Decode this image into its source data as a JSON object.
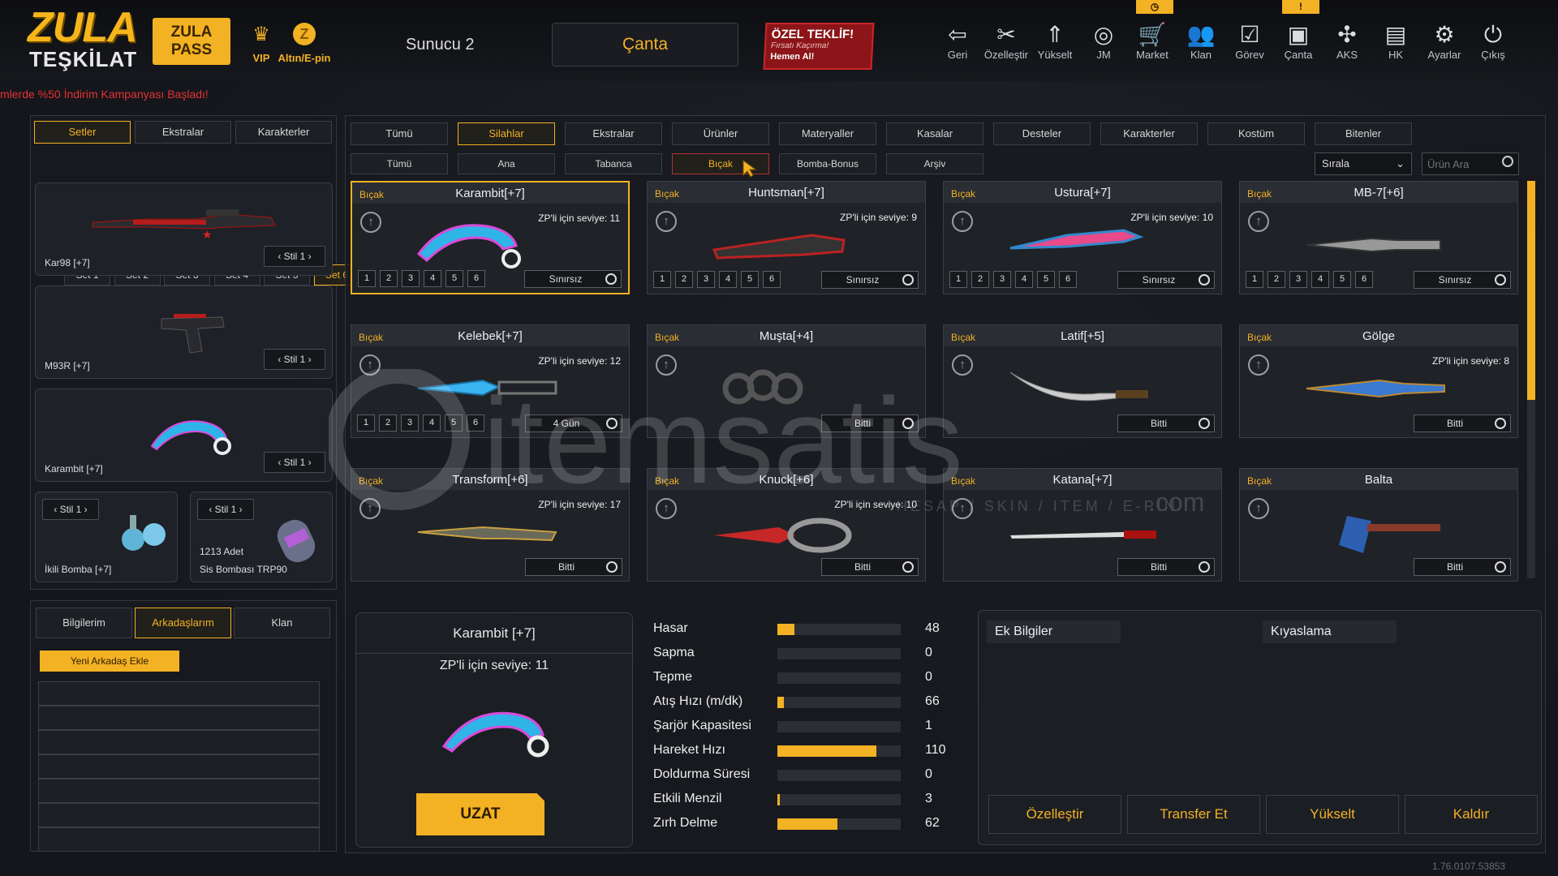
{
  "brand": {
    "line1": "ZULA",
    "line2": "TEŞKİLAT",
    "pass": "ZULA\nPASS"
  },
  "top": {
    "vip": "VIP",
    "altin": "Altın/E-pin",
    "server": "Sunucu 2",
    "canta": "Çanta",
    "offer": {
      "title": "ÖZEL TEKLİF!",
      "sub": "Fırsatı Kaçırma!",
      "cta": "Hemen Al!"
    }
  },
  "nav": [
    {
      "label": "Geri",
      "icon": "back-icon"
    },
    {
      "label": "Özelleştir",
      "icon": "customize-icon"
    },
    {
      "label": "Yükselt",
      "icon": "upgrade-icon"
    },
    {
      "label": "JM",
      "icon": "coins-icon"
    },
    {
      "label": "Market",
      "icon": "cart-icon"
    },
    {
      "label": "Klan",
      "icon": "clan-icon"
    },
    {
      "label": "Görev",
      "icon": "mission-icon"
    },
    {
      "label": "Çanta",
      "icon": "bag-icon"
    },
    {
      "label": "AKS",
      "icon": "aks-icon"
    },
    {
      "label": "HK",
      "icon": "wallet-icon"
    },
    {
      "label": "Ayarlar",
      "icon": "gear-icon"
    },
    {
      "label": "Çıkış",
      "icon": "power-icon"
    }
  ],
  "badges": {
    "market": "◷",
    "canta": "!"
  },
  "marquee": "mlerde %50 İndirim Kampanyası Başladı!",
  "left": {
    "tabs": [
      "Setler",
      "Ekstralar",
      "Karakterler"
    ],
    "sets": [
      "Set 1",
      "Set 2",
      "Set 3",
      "Set 4",
      "Set 5",
      "Set 6"
    ],
    "slots": [
      {
        "name": "Kar98 [+7]",
        "stil": "Stil 1"
      },
      {
        "name": "M93R [+7]",
        "stil": "Stil 1"
      },
      {
        "name": "Karambit [+7]",
        "stil": "Stil 1"
      }
    ],
    "small": [
      {
        "name": "İkili Bomba [+7]",
        "stil": "Stil 1"
      },
      {
        "count": "1213 Adet",
        "name": "Sis Bombası TRP90",
        "stil": "Stil 1"
      }
    ]
  },
  "social": {
    "tabs": [
      "Bilgilerim",
      "Arkadaşlarım",
      "Klan"
    ],
    "add": "Yeni Arkadaş Ekle"
  },
  "categories": [
    "Tümü",
    "Silahlar",
    "Ekstralar",
    "Ürünler",
    "Materyaller",
    "Kasalar",
    "Desteler",
    "Karakterler",
    "Kostüm",
    "Bitenler"
  ],
  "subcategories": [
    "Tümü",
    "Ana",
    "Tabanca",
    "Bıçak",
    "Bomba-Bonus",
    "Arşiv"
  ],
  "sort": "Sırala",
  "search_placeholder": "Ürün Ara",
  "items": [
    {
      "cat": "Bıçak",
      "name": "Karambit[+7]",
      "zp": "ZP'li için seviye: 11",
      "dur": "Sınırsız",
      "levels": [
        "1",
        "2",
        "3",
        "4",
        "5",
        "6"
      ]
    },
    {
      "cat": "Bıçak",
      "name": "Huntsman[+7]",
      "zp": "ZP'li için seviye: 9",
      "dur": "Sınırsız",
      "levels": [
        "1",
        "2",
        "3",
        "4",
        "5",
        "6"
      ]
    },
    {
      "cat": "Bıçak",
      "name": "Ustura[+7]",
      "zp": "ZP'li için seviye: 10",
      "dur": "Sınırsız",
      "levels": [
        "1",
        "2",
        "3",
        "4",
        "5",
        "6"
      ]
    },
    {
      "cat": "Bıçak",
      "name": "MB-7[+6]",
      "zp": "",
      "dur": "Sınırsız",
      "levels": [
        "1",
        "2",
        "3",
        "4",
        "5",
        "6"
      ]
    },
    {
      "cat": "Bıçak",
      "name": "Kelebek[+7]",
      "zp": "ZP'li için seviye: 12",
      "dur": "4 Gün",
      "levels": [
        "1",
        "2",
        "3",
        "4",
        "5",
        "6"
      ]
    },
    {
      "cat": "Bıçak",
      "name": "Muşta[+4]",
      "zp": "",
      "dur": "Bitti",
      "levels": []
    },
    {
      "cat": "Bıçak",
      "name": "Latif[+5]",
      "zp": "",
      "dur": "Bitti",
      "levels": []
    },
    {
      "cat": "Bıçak",
      "name": "Gölge",
      "zp": "ZP'li için seviye: 8",
      "dur": "Bitti",
      "levels": []
    },
    {
      "cat": "Bıçak",
      "name": "Transform[+6]",
      "zp": "ZP'li için seviye: 17",
      "dur": "Bitti",
      "levels": []
    },
    {
      "cat": "Bıçak",
      "name": "Knuck[+6]",
      "zp": "ZP'li için seviye: 10",
      "dur": "Bitti",
      "levels": []
    },
    {
      "cat": "Bıçak",
      "name": "Katana[+7]",
      "zp": "",
      "dur": "Bitti",
      "levels": []
    },
    {
      "cat": "Bıçak",
      "name": "Balta",
      "zp": "",
      "dur": "Bitti",
      "levels": []
    }
  ],
  "detail": {
    "name": "Karambit [+7]",
    "zp": "ZP'li için seviye: 11",
    "extend": "UZAT"
  },
  "stats": [
    {
      "label": "Hasar",
      "value": "48",
      "fill": 0.14
    },
    {
      "label": "Sapma",
      "value": "0",
      "fill": 0
    },
    {
      "label": "Tepme",
      "value": "0",
      "fill": 0
    },
    {
      "label": "Atış Hızı (m/dk)",
      "value": "66",
      "fill": 0.05
    },
    {
      "label": "Şarjör Kapasitesi",
      "value": "1",
      "fill": 0
    },
    {
      "label": "Hareket Hızı",
      "value": "110",
      "fill": 0.8
    },
    {
      "label": "Doldurma Süresi",
      "value": "0",
      "fill": 0
    },
    {
      "label": "Etkili Menzil",
      "value": "3",
      "fill": 0.02
    },
    {
      "label": "Zırh Delme",
      "value": "62",
      "fill": 0.49
    }
  ],
  "info": {
    "ek": "Ek Bilgiler",
    "kiyas": "Kıyaslama"
  },
  "actions": [
    "Özelleştir",
    "Transfer Et",
    "Yükselt",
    "Kaldır"
  ],
  "watermark": {
    "text": "itemsatis",
    "tagline": "HESAP / SKIN / ITEM / E-PIN",
    "com": ".com"
  },
  "version": "1.76.0107.53853",
  "colors": {
    "accent": "#f3b124",
    "danger": "#e53232"
  }
}
